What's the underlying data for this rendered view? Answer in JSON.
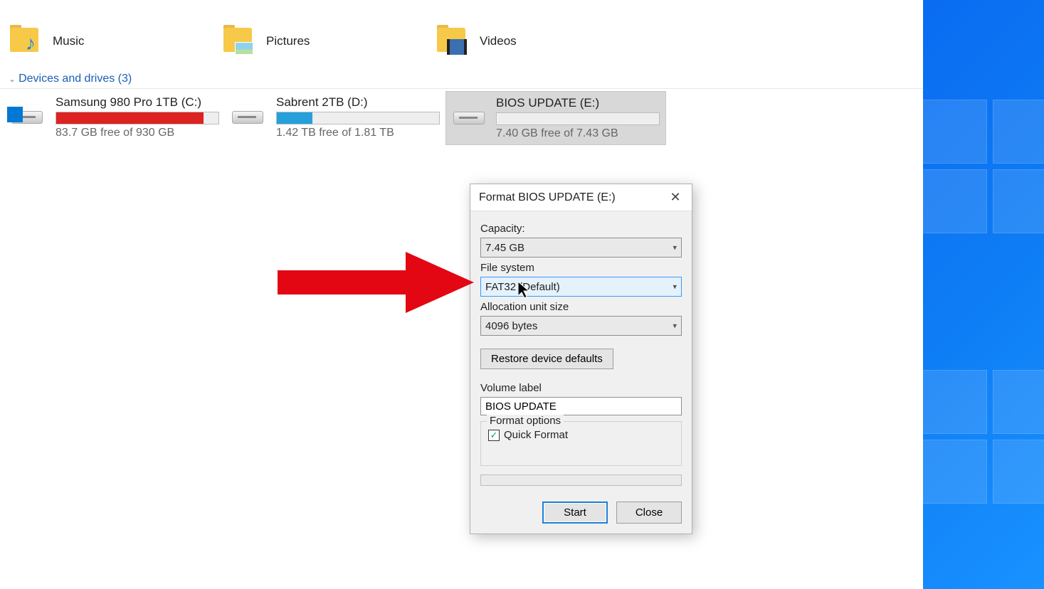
{
  "folders": {
    "music": "Music",
    "pictures": "Pictures",
    "videos": "Videos"
  },
  "section": {
    "label": "Devices and drives (3)"
  },
  "drives": [
    {
      "name": "Samsung 980 Pro 1TB (C:)",
      "fill_pct": 91,
      "color": "red",
      "free": "83.7 GB free of 930 GB",
      "system": true
    },
    {
      "name": "Sabrent 2TB (D:)",
      "fill_pct": 22,
      "color": "blue",
      "free": "1.42 TB free of 1.81 TB",
      "system": false
    },
    {
      "name": "BIOS UPDATE (E:)",
      "fill_pct": 1,
      "color": "grey",
      "free": "7.40 GB free of 7.43 GB",
      "system": false
    }
  ],
  "dialog": {
    "title": "Format BIOS UPDATE (E:)",
    "capacity_label": "Capacity:",
    "capacity_value": "7.45 GB",
    "filesystem_label": "File system",
    "filesystem_value": "FAT32 (Default)",
    "alloc_label": "Allocation unit size",
    "alloc_value": "4096 bytes",
    "restore_button": "Restore device defaults",
    "volume_label_caption": "Volume label",
    "volume_label_value": "BIOS UPDATE",
    "format_options_legend": "Format options",
    "quick_format_label": "Quick Format",
    "start_button": "Start",
    "close_button": "Close"
  }
}
